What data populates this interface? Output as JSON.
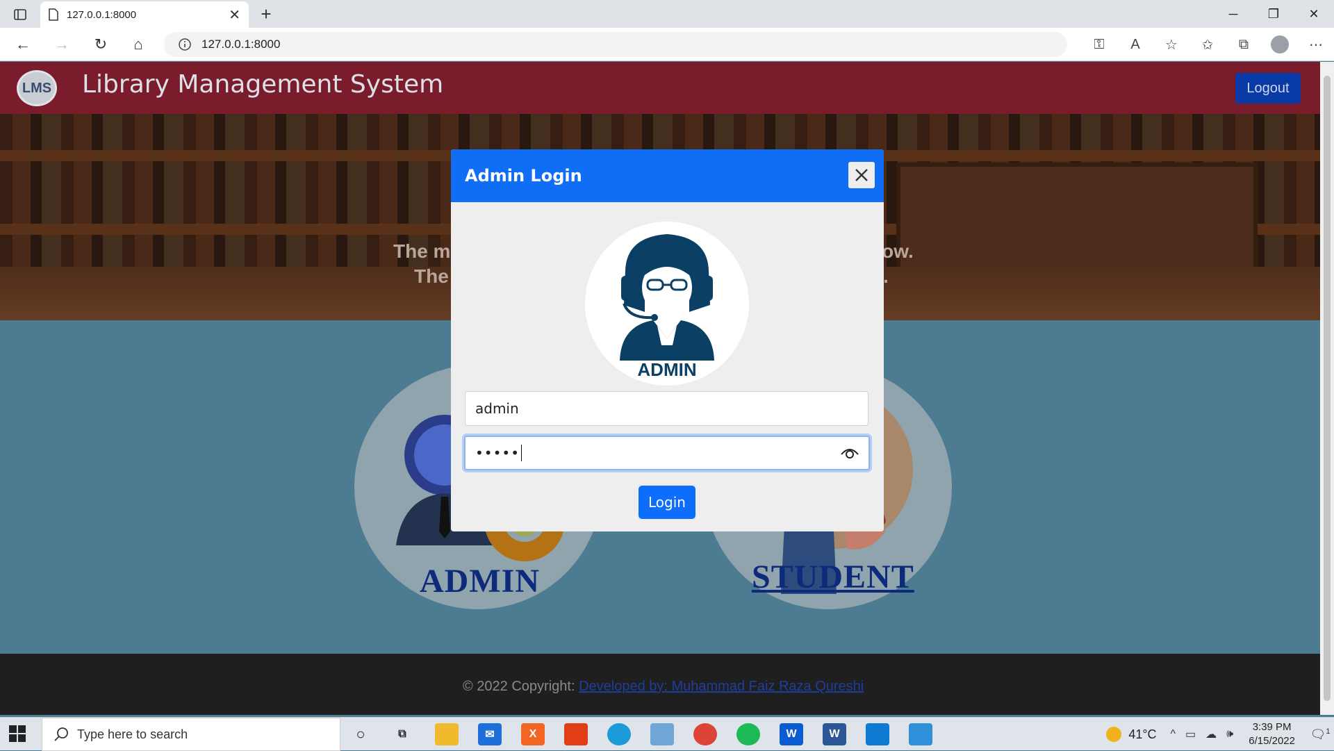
{
  "browser": {
    "tab_title": "127.0.0.1:8000",
    "url": "127.0.0.1:8000"
  },
  "navbar": {
    "logo_text": "LMS",
    "site_title": "Library Management System",
    "logout_label": "Logout"
  },
  "hero": {
    "line1_left": "The m",
    "line1_right": "now.",
    "line2_left": "The",
    "line2_right": "o."
  },
  "roles": {
    "admin_label": "ADMIN",
    "student_label": "STUDENT"
  },
  "footer": {
    "copyright": "© 2022 Copyright: ",
    "link_text": "Developed by: Muhammad Faiz Raza Qureshi"
  },
  "modal": {
    "title": "Admin Login",
    "avatar_caption": "ADMIN",
    "username_value": "admin",
    "password_mask": "•••••",
    "login_label": "Login"
  },
  "taskbar": {
    "search_placeholder": "Type here to search",
    "weather": "41°C",
    "time": "3:39 PM",
    "date": "6/15/2022",
    "notification_count": "1"
  }
}
